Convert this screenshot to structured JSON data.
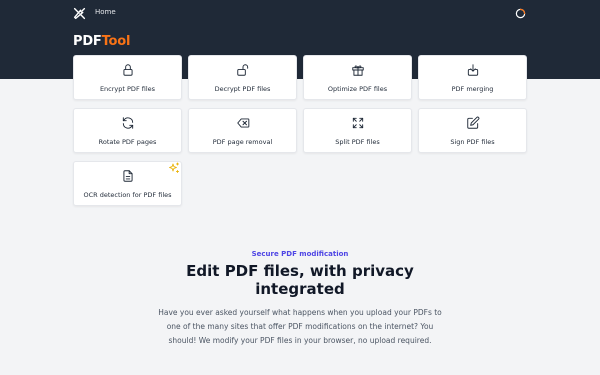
{
  "nav": {
    "logo_icon": "tools-icon",
    "home_label": "Home",
    "theme_icon": "theme-toggle-icon"
  },
  "brand": {
    "part1": "PDF",
    "part2": "Tool",
    "accent_color": "#f97316"
  },
  "tools": [
    {
      "label": "Encrypt PDF files",
      "icon": "lock-icon"
    },
    {
      "label": "Decrypt PDF files",
      "icon": "unlock-icon"
    },
    {
      "label": "Optimize PDF files",
      "icon": "gift-icon"
    },
    {
      "label": "PDF merging",
      "icon": "merge-icon"
    },
    {
      "label": "Rotate PDF pages",
      "icon": "rotate-icon"
    },
    {
      "label": "PDF page removal",
      "icon": "backspace-icon"
    },
    {
      "label": "Split PDF files",
      "icon": "split-icon"
    },
    {
      "label": "Sign PDF files",
      "icon": "pen-icon"
    },
    {
      "label": "OCR detection for PDF files",
      "icon": "document-icon",
      "badge_icon": "sparkle-icon"
    }
  ],
  "hero": {
    "eyebrow": "Secure PDF modification",
    "headline": "Edit PDF files, with privacy integrated",
    "description": "Have you ever asked yourself what happens when you upload your PDFs to one of the many sites that offer PDF modifications on the internet? You should! We modify your PDF files in your browser, no upload required."
  },
  "colors": {
    "header_bg": "#1f2937",
    "eyebrow": "#4f46e5",
    "page_bg": "#f3f4f6"
  }
}
